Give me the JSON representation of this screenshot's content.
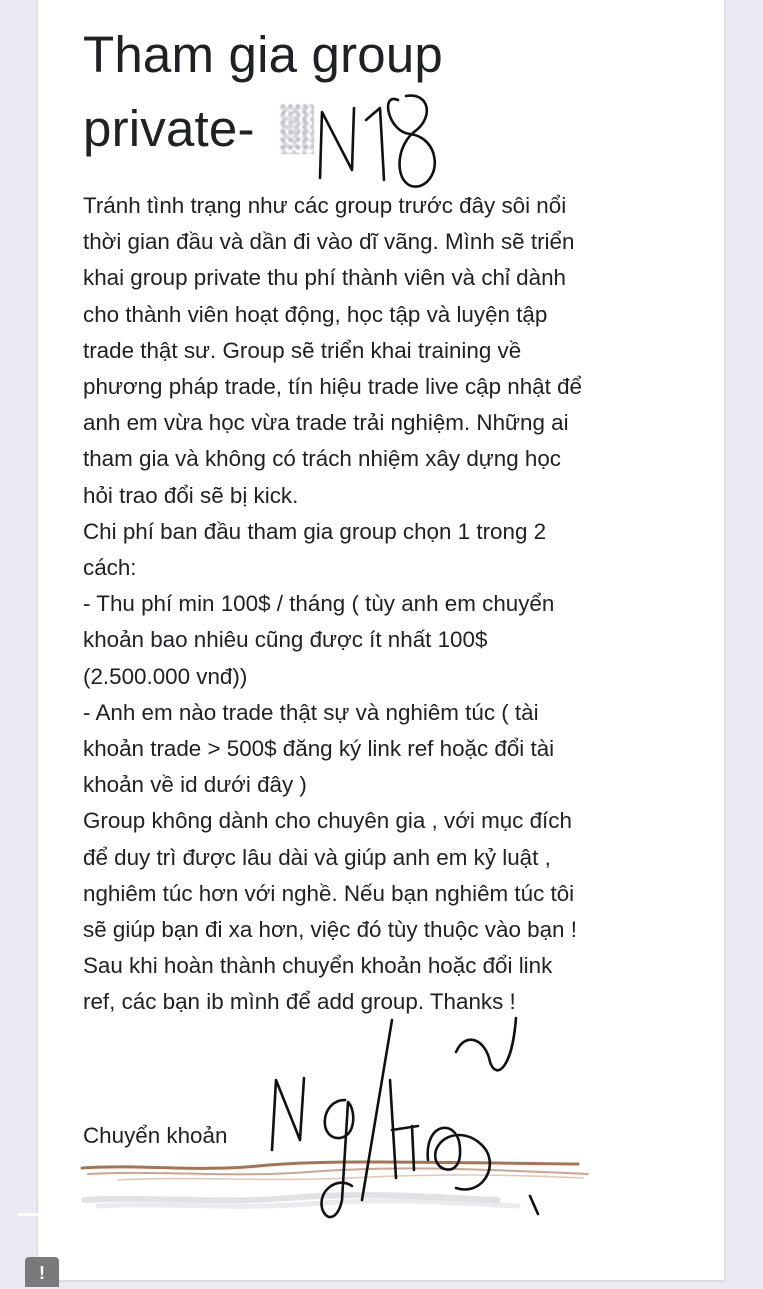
{
  "form": {
    "title_line1": "Tham gia group",
    "title_line2": "private-",
    "title_scribble": "N18",
    "body_lines": [
      "Tránh tình trạng như các group trước đây sôi nổi",
      "thời gian đầu và dần đi vào dĩ vãng. Mình sẽ triển",
      "khai group private thu phí thành viên và chỉ dành",
      "cho thành viên hoạt động, học tập và luyện tập",
      "trade thật sư. Group sẽ triển khai training  về",
      "phương pháp trade, tín hiệu trade live cập nhật để",
      "anh em vừa học vừa trade trải nghiệm. Những ai",
      "tham gia và không có trách nhiệm xây dựng học",
      "hỏi trao đổi sẽ bị kick.",
      "Chi phí ban đầu tham gia group chọn 1 trong 2",
      "cách:",
      "- Thu phí min 100$ / tháng ( tùy anh em chuyển",
      "khoản bao nhiêu cũng được ít nhất 100$",
      "(2.500.000 vnđ))",
      "- Anh em nào trade thật sự và nghiêm túc ( tài",
      "khoản trade > 500$ đăng ký link ref hoặc đổi tài",
      "khoản về id dưới  đây )",
      "Group không dành cho chuyên gia , với mục đích",
      "để duy trì được lâu dài và giúp anh em kỷ luật ,",
      "nghiêm túc hơn với nghề. Nếu bạn nghiêm túc tôi",
      "sẽ giúp bạn đi xa hơn, việc đó tùy thuộc vào bạn !",
      "Sau khi hoàn thành chuyển khoản hoặc đổi link",
      "ref, các bạn ib mình để add group. Thanks !"
    ],
    "transfer_label": "Chuyển khoản",
    "signature_text": "Ngư",
    "fab_symbol": "!"
  },
  "colors": {
    "page_background": "#ede9f2",
    "card_background": "#ffffff",
    "text": "#202124",
    "scribble_ink": "#111111",
    "redaction_brown": "#8b4a22",
    "fab": "#7a7a7d"
  },
  "icons": {
    "feedback": "exclamation-icon"
  }
}
